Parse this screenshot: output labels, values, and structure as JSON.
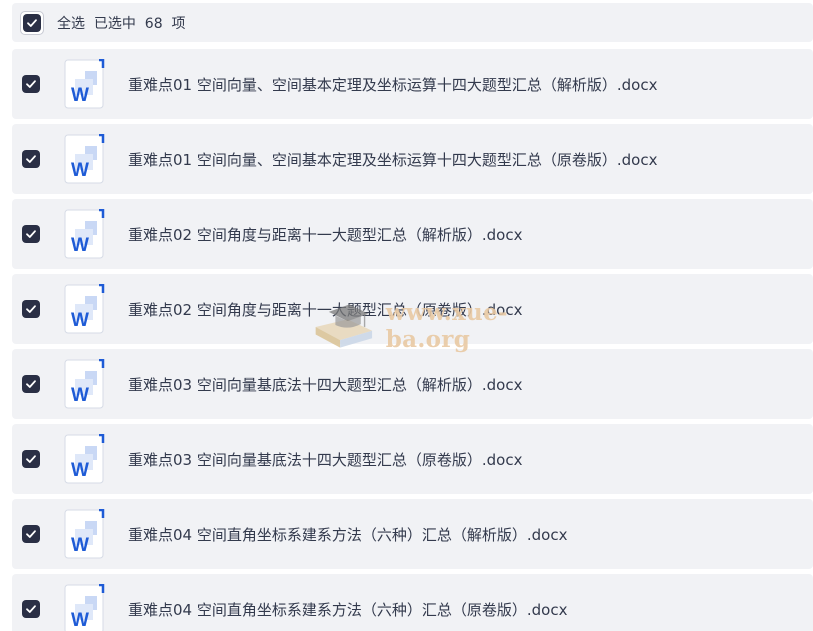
{
  "header": {
    "select_all_label": "全选  已选中  68  项"
  },
  "files": [
    {
      "name": "重难点01 空间向量、空间基本定理及坐标运算十四大题型汇总（解析版）.docx",
      "icon": "word-doc-icon",
      "checked": true
    },
    {
      "name": "重难点01 空间向量、空间基本定理及坐标运算十四大题型汇总（原卷版）.docx",
      "icon": "word-doc-icon",
      "checked": true
    },
    {
      "name": "重难点02 空间角度与距离十一大题型汇总（解析版）.docx",
      "icon": "word-doc-icon",
      "checked": true
    },
    {
      "name": "重难点02 空间角度与距离十一大题型汇总（原卷版）.docx",
      "icon": "word-doc-icon",
      "checked": true
    },
    {
      "name": "重难点03 空间向量基底法十四大题型汇总（解析版）.docx",
      "icon": "word-doc-icon",
      "checked": true
    },
    {
      "name": "重难点03 空间向量基底法十四大题型汇总（原卷版）.docx",
      "icon": "word-doc-icon",
      "checked": true
    },
    {
      "name": "重难点04 空间直角坐标系建系方法（六种）汇总（解析版）.docx",
      "icon": "word-doc-icon",
      "checked": true
    },
    {
      "name": "重难点04 空间直角坐标系建系方法（六种）汇总（原卷版）.docx",
      "icon": "word-doc-icon",
      "checked": true
    }
  ],
  "watermark": {
    "text": "www.xue-ba.org"
  },
  "colors": {
    "row_bg": "#f1f2f5",
    "checkbox": "#2a2f45",
    "word_blue": "#1e5bd6",
    "text": "#333a4d"
  }
}
